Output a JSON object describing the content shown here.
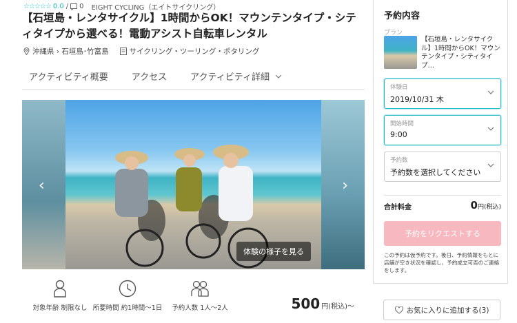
{
  "header": {
    "stars": "☆☆☆☆☆",
    "score": "0.0",
    "divider": "/",
    "review_count": "0",
    "provider": "EIGHT CYCLING（エイトサイクリング）",
    "title": "【石垣島・レンタサイクル】1時間からOK！マウンテンタイプ・シティタイプから選べる！電動アシスト自転車レンタル",
    "location": "沖縄県 › 石垣島･竹富島",
    "category": "サイクリング・ツーリング・ポタリング"
  },
  "tabs": [
    {
      "label": "アクティビティ概要"
    },
    {
      "label": "アクセス"
    },
    {
      "label": "アクティビティ詳細"
    }
  ],
  "gallery": {
    "see_label": "体験の様子を見る"
  },
  "facts": [
    {
      "label": "対象年齢 制限なし",
      "icon": "person-icon"
    },
    {
      "label": "所要時間 約1時間〜1日",
      "icon": "clock-icon"
    },
    {
      "label": "予約人数 1人〜2人",
      "icon": "people-icon"
    }
  ],
  "price": {
    "value": "500",
    "unit": "円(税込)〜"
  },
  "booking": {
    "title": "予約内容",
    "plan_label": "プラン",
    "plan_text": "【石垣島・レンタサイクル】1時間からOK！マウンテンタイプ・シティタイプ…",
    "date_label": "体験日",
    "date_value": "2019/10/31 木",
    "time_label": "開始時間",
    "time_value": "9:00",
    "people_label": "予約数",
    "people_value": "予約数を選択してください",
    "total_label": "合計料金",
    "total_value": "0",
    "total_unit": "円(税込)",
    "request_label": "予約をリクエストする",
    "note": "この予約は仮予約です。後日、予約情報をもとに店舗が空き状況を確認し、予約成立可否のご連絡をします。"
  },
  "favorite": {
    "label": "お気に入りに追加する(3)"
  },
  "colors": {
    "accent": "#1fb8c7",
    "request_button": "#f7b8bf"
  }
}
